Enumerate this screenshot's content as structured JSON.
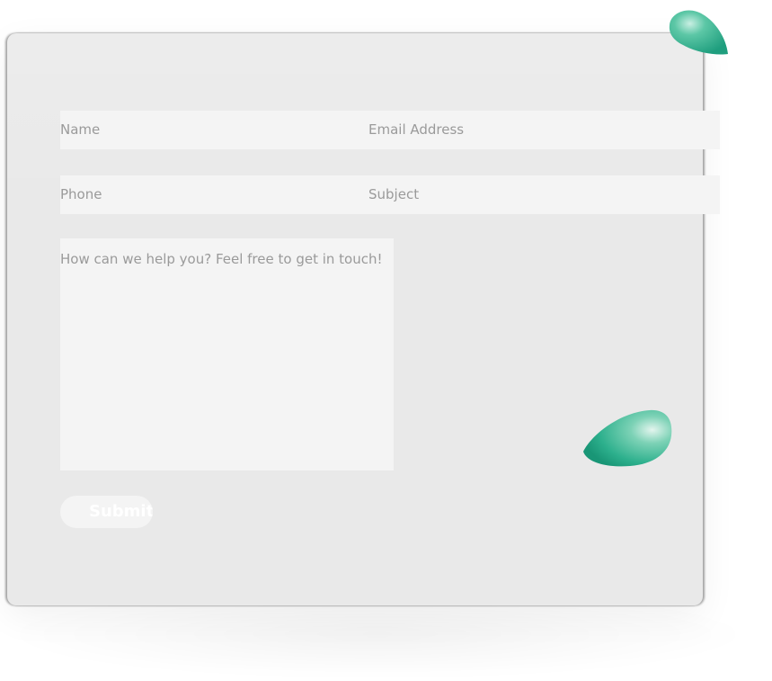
{
  "form": {
    "name_placeholder": "Name",
    "email_placeholder": "Email Address",
    "phone_placeholder": "Phone",
    "subject_placeholder": "Subject",
    "message_placeholder": "How can we help you? Feel free to get in touch!",
    "submit_label": "Submit"
  },
  "colors": {
    "card": "#e9e9e9",
    "field": "#f4f4f4",
    "placeholder_text": "#9a9a9a",
    "blob_accent": "#2bb391"
  }
}
